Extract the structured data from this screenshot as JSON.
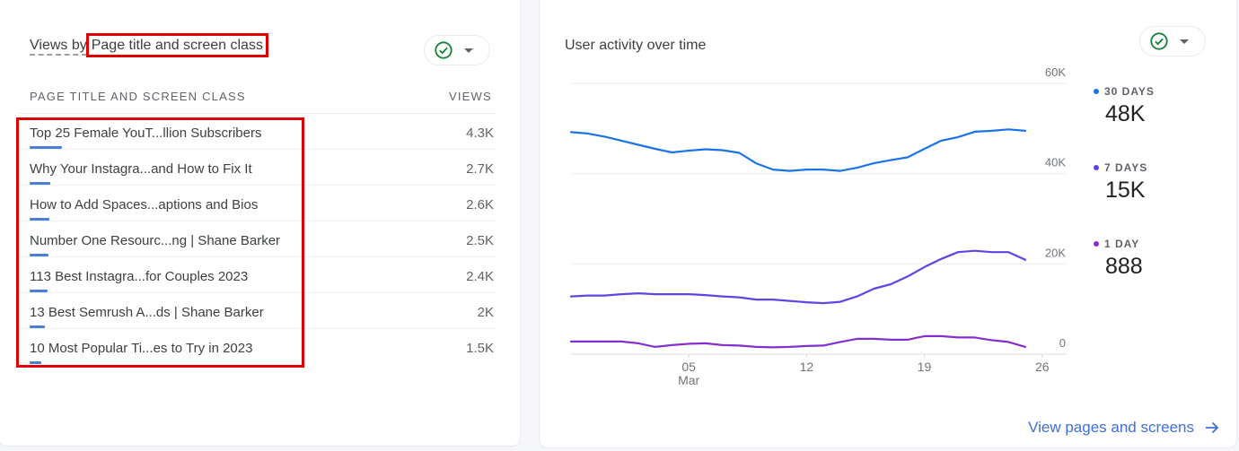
{
  "left_card": {
    "title_prefix": "Views by",
    "title_dimension": "Page title and screen class",
    "column_dimension": "PAGE TITLE AND SCREEN CLASS",
    "column_metric": "VIEWS",
    "rows": [
      {
        "label": "Top 25 Female YouT...llion Subscribers",
        "value": "4.3K",
        "fraction": 1.0
      },
      {
        "label": "Why Your Instagra...and How to Fix It",
        "value": "2.7K",
        "fraction": 0.63
      },
      {
        "label": "How to Add Spaces...aptions and Bios",
        "value": "2.6K",
        "fraction": 0.6
      },
      {
        "label": "Number One Resourc...ng | Shane Barker",
        "value": "2.5K",
        "fraction": 0.58
      },
      {
        "label": "113 Best Instagra...for Couples 2023",
        "value": "2.4K",
        "fraction": 0.56
      },
      {
        "label": "13 Best Semrush A...ds | Shane Barker",
        "value": "2K",
        "fraction": 0.47
      },
      {
        "label": "10 Most Popular Ti...es to Try in 2023",
        "value": "1.5K",
        "fraction": 0.35
      }
    ],
    "link_label": "View pages and screens",
    "colors": {
      "bar": "#4a7fd6",
      "highlight": "#e00000",
      "link": "#3f6fd8",
      "check": "#188038"
    }
  },
  "right_card": {
    "title": "User activity over time"
  },
  "chart_data": {
    "type": "line",
    "title": "User activity over time",
    "x_label": "",
    "y_label": "",
    "ylim": [
      0,
      60000
    ],
    "y_ticks": [
      "0",
      "20K",
      "40K",
      "60K"
    ],
    "y_tick_values": [
      0,
      20000,
      40000,
      60000
    ],
    "x_tick_days": [
      5,
      12,
      19,
      26
    ],
    "x_tick_labels": [
      "05",
      "12",
      "19",
      "26"
    ],
    "x_month_label": "Mar",
    "x_start_offset_days": -7,
    "grid": true,
    "legend_position": "right",
    "series": [
      {
        "name": "30 DAYS",
        "summary": "48K",
        "color": "#1a73e8",
        "values": [
          49200,
          48900,
          48200,
          47300,
          46400,
          45500,
          44700,
          45100,
          45400,
          45200,
          44600,
          42300,
          40900,
          40600,
          40900,
          40900,
          40600,
          41300,
          42300,
          43000,
          43600,
          45500,
          47300,
          48100,
          49300,
          49500,
          49800,
          49500
        ]
      },
      {
        "name": "7 DAYS",
        "summary": "15K",
        "color": "#5b47e6",
        "values": [
          12800,
          13000,
          13000,
          13300,
          13500,
          13300,
          13300,
          13300,
          13100,
          12800,
          12600,
          12100,
          12100,
          11800,
          11500,
          11300,
          11600,
          12800,
          14500,
          15500,
          17200,
          19300,
          21100,
          22600,
          22900,
          22600,
          22600,
          20900
        ]
      },
      {
        "name": "1 DAY",
        "summary": "888",
        "color": "#8430ce",
        "values": [
          2800,
          2800,
          2800,
          2800,
          2400,
          1600,
          2000,
          2300,
          2400,
          2000,
          1900,
          1600,
          1500,
          1600,
          1800,
          1900,
          2700,
          3400,
          3400,
          3200,
          3200,
          4000,
          4000,
          3700,
          3700,
          3100,
          2700,
          1600
        ]
      }
    ]
  }
}
